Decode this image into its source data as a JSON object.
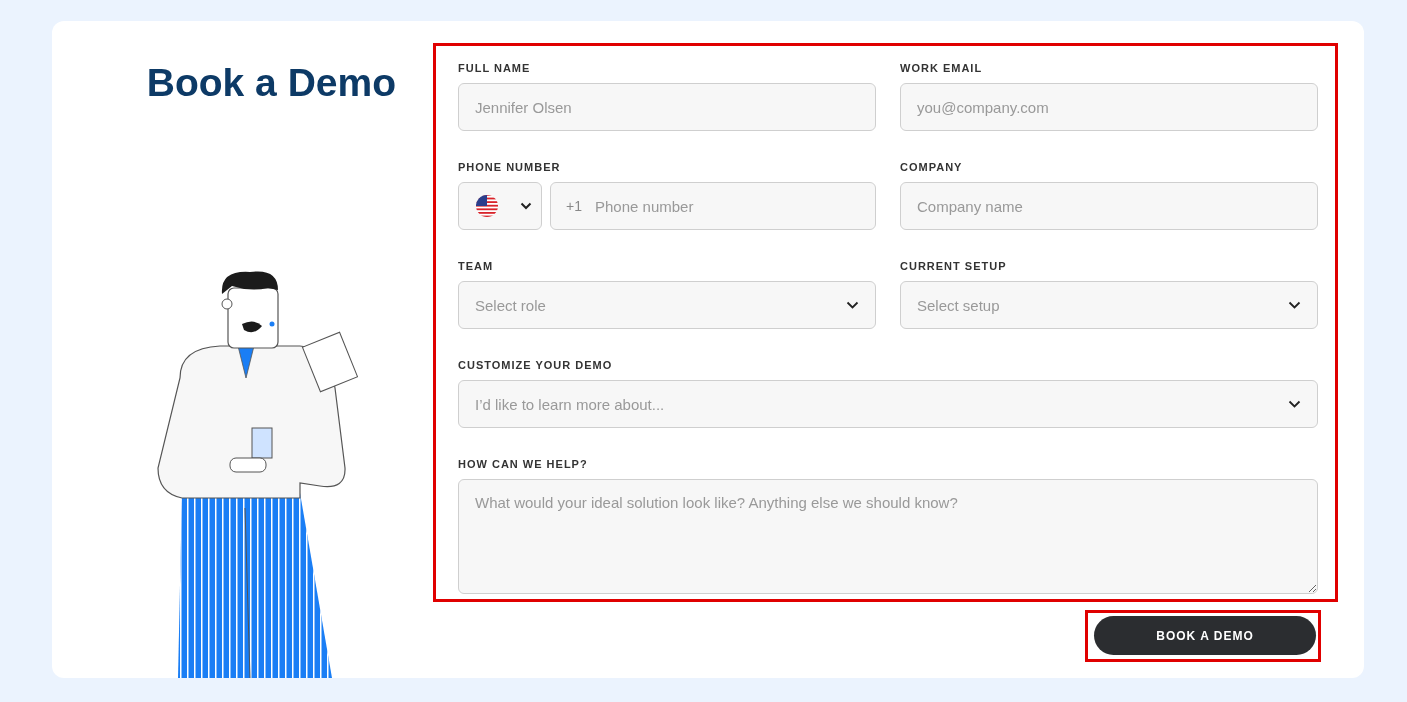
{
  "title": "Book a Demo",
  "rows": [
    [
      {
        "kind": "text",
        "label": "FULL NAME",
        "placeholder": "Jennifer Olsen"
      },
      {
        "kind": "text",
        "label": "WORK EMAIL",
        "placeholder": "you@company.com"
      }
    ],
    [
      {
        "kind": "phone",
        "label": "PHONE NUMBER",
        "prefix": "+1",
        "placeholder": "Phone number"
      },
      {
        "kind": "text",
        "label": "COMPANY",
        "placeholder": "Company name"
      }
    ],
    [
      {
        "kind": "select",
        "label": "TEAM",
        "placeholder": "Select role"
      },
      {
        "kind": "select",
        "label": "CURRENT SETUP",
        "placeholder": "Select setup"
      }
    ],
    [
      {
        "kind": "select",
        "label": "CUSTOMIZE YOUR DEMO",
        "placeholder": "I’d like to learn more about..."
      }
    ],
    [
      {
        "kind": "textarea",
        "label": "HOW CAN WE HELP?",
        "placeholder": "What would your ideal solution look like? Anything else we should know?"
      }
    ]
  ],
  "submit": "BOOK A DEMO"
}
